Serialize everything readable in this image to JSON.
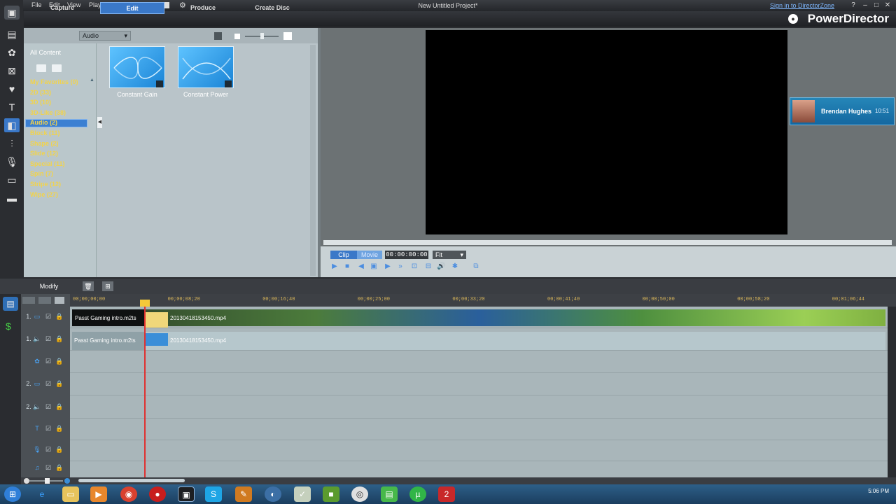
{
  "menu": {
    "file": "File",
    "edit": "Edit",
    "view": "View",
    "playback": "Playback"
  },
  "window": {
    "title": "New Untitled Project*",
    "signin": "Sign in to DirectorZone",
    "brand": "PowerDirector"
  },
  "modes": {
    "capture": "Capture",
    "edit": "Edit",
    "produce": "Produce",
    "create_disc": "Create Disc"
  },
  "library": {
    "type_select": "Audio",
    "all_content": "All Content",
    "categories": [
      "My Favorites  (0)",
      "2D  (33)",
      "3D  (10)",
      "3D-Like  (38)",
      "Audio  (2)",
      "Block  (11)",
      "Shape  (2)",
      "Slide  (12)",
      "Special  (11)",
      "Spin  (7)",
      "Stripe  (12)",
      "Wipe  (27)"
    ],
    "items": [
      {
        "label": "Constant Gain"
      },
      {
        "label": "Constant Power"
      }
    ]
  },
  "preview": {
    "clip": "Clip",
    "movie": "Movie",
    "timecode": "00:00:00:00",
    "fit": "Fit"
  },
  "notification": {
    "name": "Brendan Hughes",
    "time": "10:51"
  },
  "timeline": {
    "modify": "Modify",
    "ticks": [
      "00;00;00;00",
      "00;00;08;20",
      "00;00;16;40",
      "00;00;25;00",
      "00;00;33;20",
      "00;00;41;40",
      "00;00;50;00",
      "00;00;58;20",
      "00;01;06;44"
    ],
    "tracks": [
      {
        "num": "1."
      },
      {
        "num": "1."
      },
      {
        "num": ""
      },
      {
        "num": "2."
      },
      {
        "num": "2."
      },
      {
        "num": ""
      },
      {
        "num": ""
      },
      {
        "num": ""
      }
    ],
    "clips": {
      "video1": "Passt Gaming intro.m2ts",
      "video2": "20130418153450.mp4",
      "audio1": "Passt Gaming intro.m2ts",
      "audio2": "20130418153450.mp4"
    }
  },
  "taskbar": {
    "clock": "5:06 PM"
  }
}
